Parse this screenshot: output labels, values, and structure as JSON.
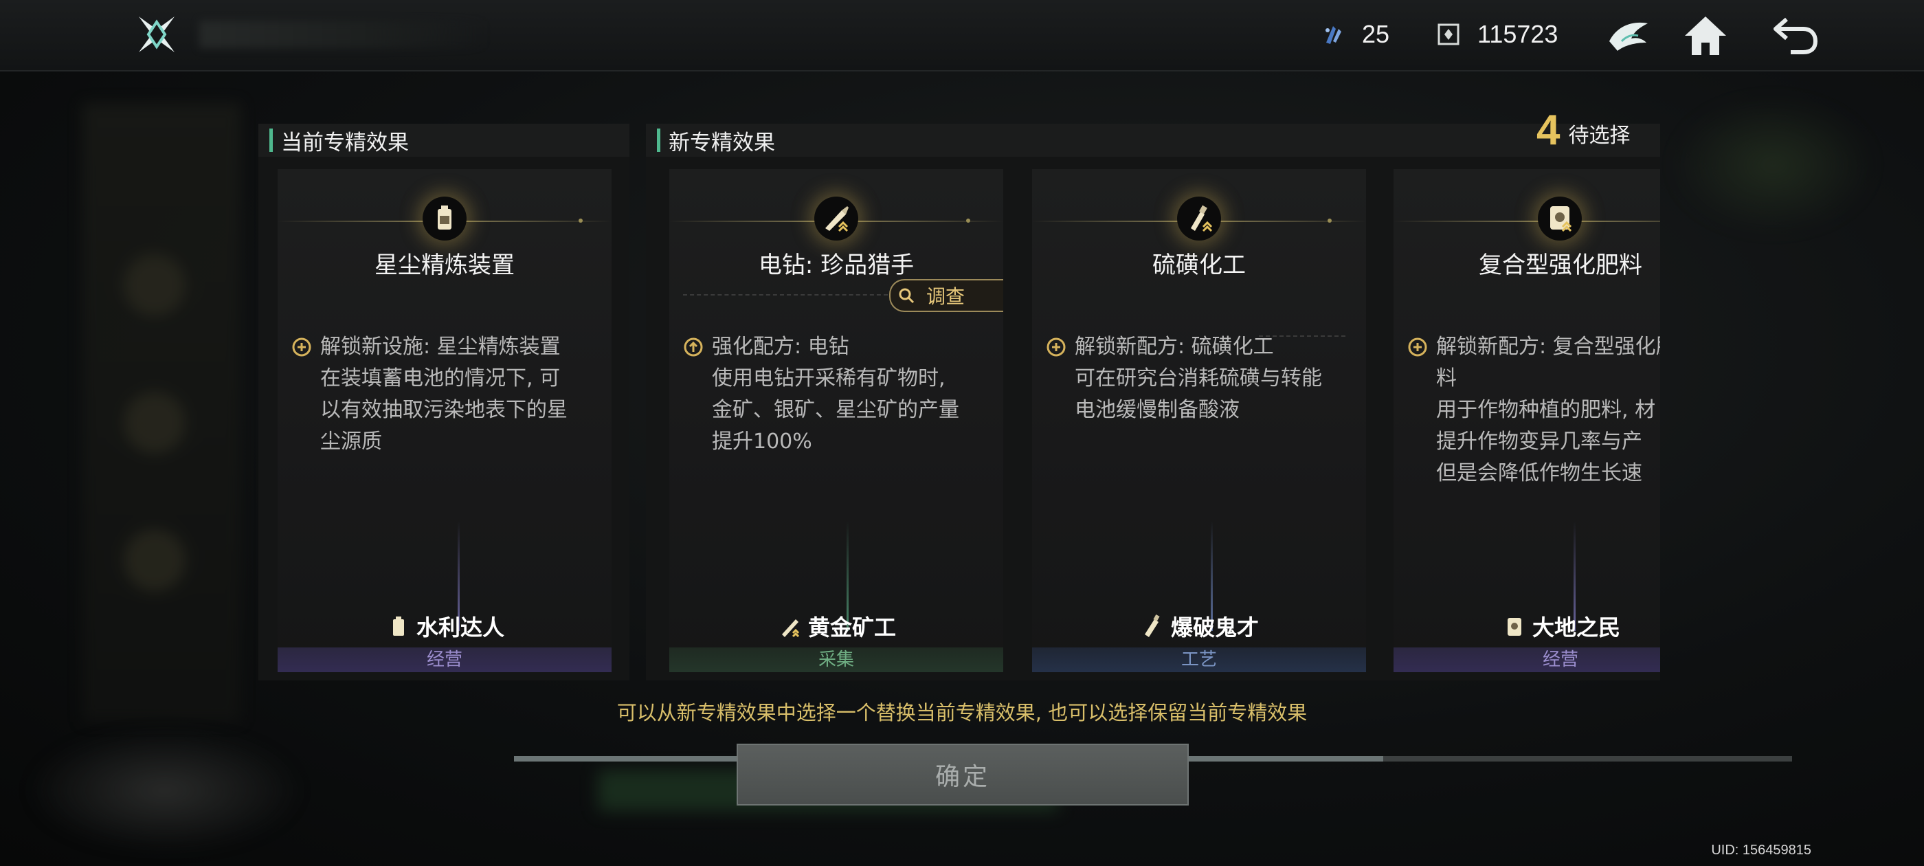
{
  "topbar": {
    "resource_1_value": "25",
    "resource_2_value": "115723"
  },
  "current_panel": {
    "heading": "当前专精效果"
  },
  "new_panel": {
    "heading": "新专精效果",
    "pending_count": "4",
    "pending_label": "待选择"
  },
  "cards": [
    {
      "title": "星尘精炼装置",
      "desc_lines": "解锁新设施: 星尘精炼装置\n在装填蓄电池的情况下, 可\n以有效抽取污染地表下的星\n尘源质",
      "badge": "水利达人",
      "category": "经营",
      "icon": "battery-icon"
    },
    {
      "title": "电钻: 珍品猎手",
      "survey_label": "调查",
      "desc_lines": "强化配方: 电钻\n使用电钻开采稀有矿物时,\n金矿、银矿、星尘矿的产量\n提升100%",
      "badge": "黄金矿工",
      "category": "采集",
      "icon": "drill-icon"
    },
    {
      "title": "硫磺化工",
      "desc_lines": "解锁新配方: 硫磺化工\n可在研究台消耗硫磺与转能\n电池缓慢制备酸液",
      "badge": "爆破鬼才",
      "category": "工艺",
      "icon": "bottle-icon"
    },
    {
      "title": "复合型强化肥料",
      "desc_lines": "解锁新配方: 复合型强化肥\n料\n用于作物种植的肥料, 材\n提升作物变异几率与产\n但是会降低作物生长速",
      "badge": "大地之民",
      "category": "经营",
      "icon": "fertilizer-bag-icon"
    }
  ],
  "hint": "可以从新专精效果中选择一个替换当前专精效果, 也可以选择保留当前专精效果",
  "confirm_label": "确定",
  "progress_fraction": 0.68,
  "uid": "UID: 156459815",
  "colors": {
    "accent_gold": "#e6c35e",
    "accent_green": "#4fb88e"
  }
}
